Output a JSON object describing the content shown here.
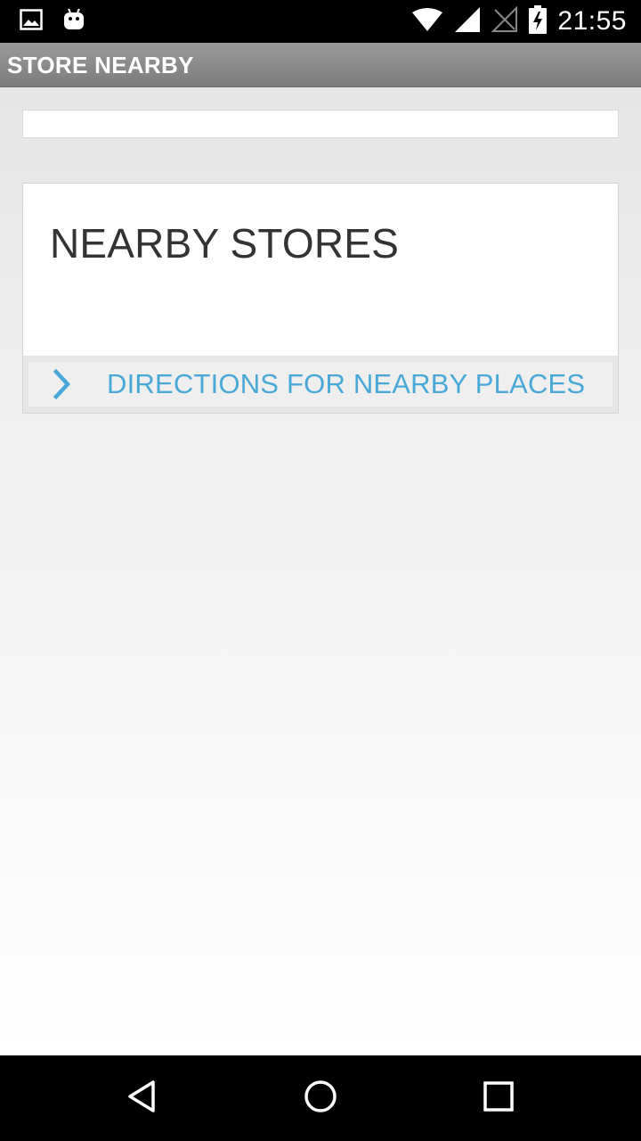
{
  "status_bar": {
    "time": "21:55",
    "left_icons": [
      "image-icon",
      "android-icon"
    ],
    "right_icons": [
      "wifi-icon",
      "signal-icon",
      "signal-empty-icon",
      "battery-charging-icon"
    ]
  },
  "app_bar": {
    "title": "STORE NEARBY"
  },
  "search": {
    "value": "",
    "placeholder": ""
  },
  "card": {
    "title": "NEARBY STORES",
    "action_label": "DIRECTIONS FOR NEARBY PLACES",
    "action_icon": "chevron-right-icon"
  },
  "nav_bar": {
    "buttons": [
      "back-icon",
      "home-icon",
      "recents-icon"
    ]
  },
  "colors": {
    "accent": "#4aa8d8",
    "app_bar": "#8a8a8a",
    "title_text": "#333333"
  }
}
